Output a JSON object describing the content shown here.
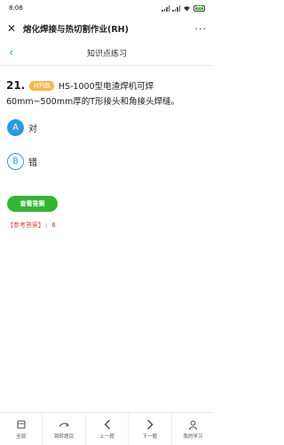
{
  "status_bar": {
    "time": "8:08",
    "battery": "80"
  },
  "window": {
    "title": "熔化焊接与热切割作业(RH)",
    "more": "···",
    "close": "✕"
  },
  "header": {
    "back": "‹",
    "title": "知识点练习"
  },
  "question": {
    "number": "21.",
    "type_badge": "对判题",
    "text": "HS-1000型电渣焊机可焊60mm~500mm厚的T形接头和角接头焊缝。",
    "options": [
      {
        "key": "A",
        "label": "对",
        "selected": true
      },
      {
        "key": "B",
        "label": "错",
        "selected": false
      }
    ]
  },
  "answer_button": "查看答案",
  "reference": "【参考答案】: B",
  "bottom_nav": [
    {
      "label": "全部",
      "icon": "grid-icon"
    },
    {
      "label": "跳转题目",
      "icon": "jump-icon"
    },
    {
      "label": "上一题",
      "icon": "chevron-left-icon"
    },
    {
      "label": "下一题",
      "icon": "chevron-right-icon"
    },
    {
      "label": "我的学习",
      "icon": "user-icon"
    }
  ],
  "colors": {
    "accent": "#2b9be0",
    "badge": "#f7b54a",
    "green": "#35b434",
    "red": "#e0463c"
  }
}
